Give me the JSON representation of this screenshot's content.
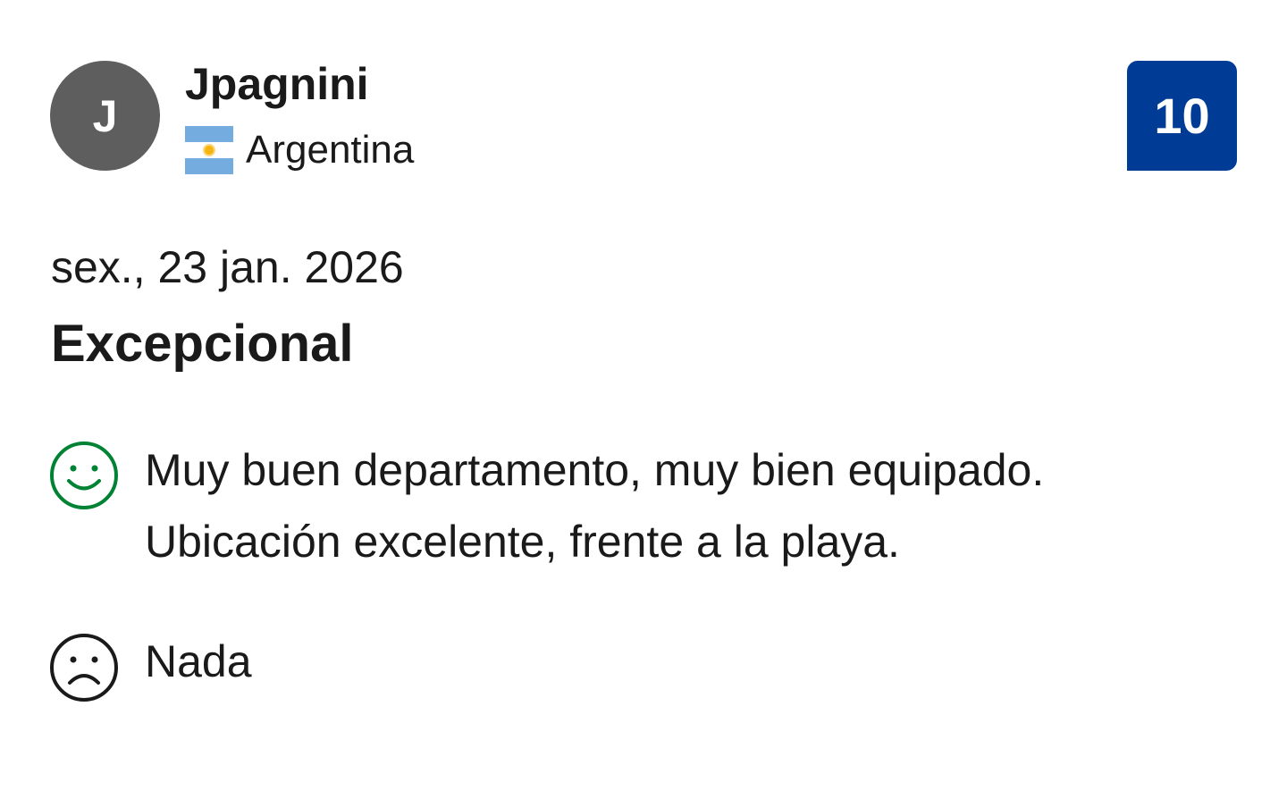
{
  "reviewer": {
    "initial": "J",
    "name": "Jpagnini",
    "country": "Argentina"
  },
  "score": "10",
  "review": {
    "date": "sex., 23 jan. 2026",
    "title": "Excepcional",
    "positive_lines": [
      "Muy buen departamento, muy bien equipado.",
      "Ubicación excelente, frente a la playa."
    ],
    "negative": "Nada"
  },
  "icons": {
    "positive": "smile-icon",
    "negative": "frown-icon",
    "flag": "argentina-flag-icon"
  },
  "colors": {
    "avatar": "#5e5e5e",
    "score_badge": "#003b95",
    "positive_icon": "#008234",
    "negative_icon": "#1a1a1a"
  }
}
